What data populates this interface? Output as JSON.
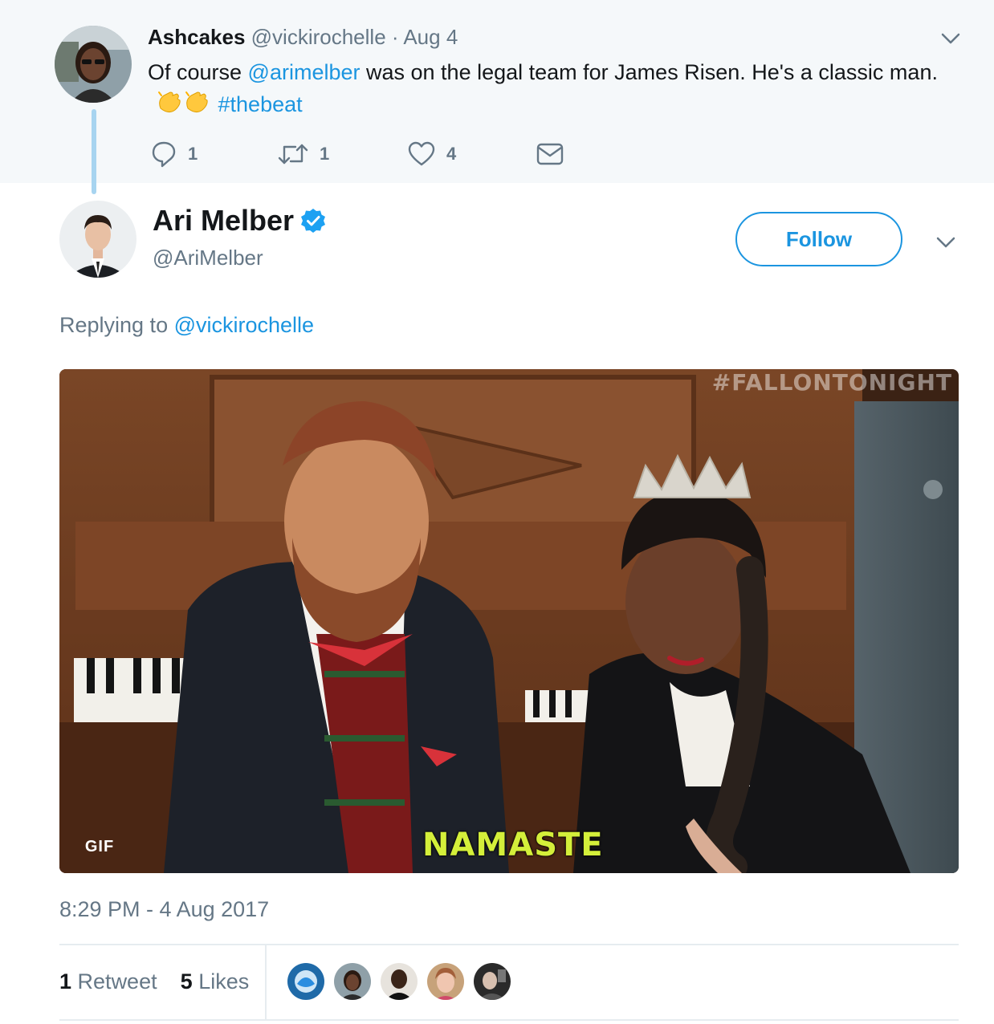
{
  "parent_tweet": {
    "name": "Ashcakes",
    "handle": "@vickirochelle",
    "separator": " · ",
    "date": "Aug 4",
    "text_before": "Of course ",
    "mention": "@arimelber",
    "text_after": " was on the legal team for James Risen. He's a classic man.",
    "hashtag": "#thebeat",
    "emoji": "clapping-hands-emoji",
    "reply_count": "1",
    "retweet_count": "1",
    "like_count": "4"
  },
  "tweet": {
    "name": "Ari Melber",
    "handle": "@AriMelber",
    "verified": true,
    "follow_label": "Follow",
    "replying_prefix": "Replying to ",
    "replying_handle": "@vickirochelle",
    "media": {
      "watermark": "#FALLONTONIGHT",
      "gif_badge": "GIF",
      "caption": "NAMASTE"
    },
    "timestamp": "8:29 PM - 4 Aug 2017",
    "retweets_num": "1",
    "retweets_label": "Retweet",
    "likes_num": "5",
    "likes_label": "Likes",
    "liker_avatars": 5
  },
  "colors": {
    "accent": "#1b95e0",
    "muted": "#657786",
    "thread_line": "#a7d4f0",
    "parent_bg": "#f5f8fa",
    "caption": "#d4ef3a"
  }
}
